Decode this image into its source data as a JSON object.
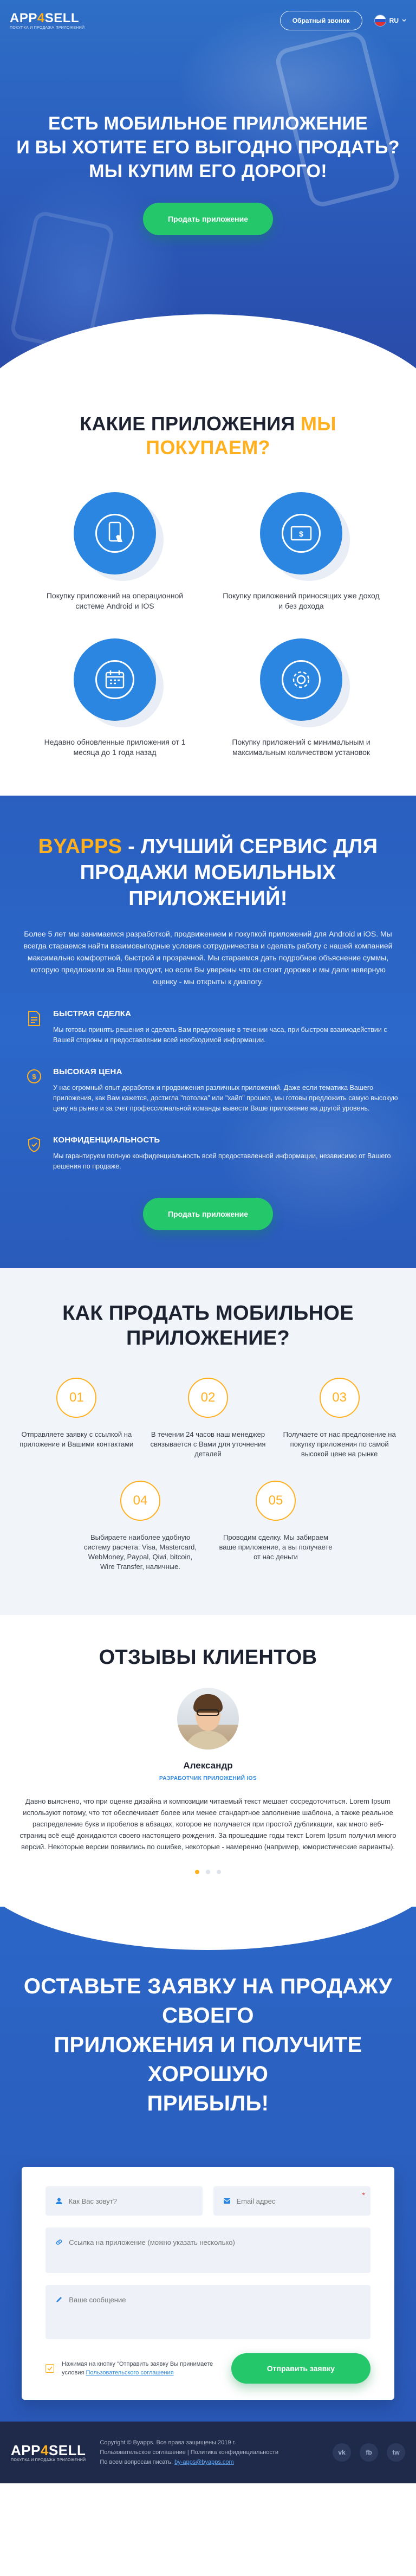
{
  "header": {
    "logo_text_a": "APP",
    "logo_text_num": "4",
    "logo_text_b": "SELL",
    "logo_tagline": "ПОКУПКА И ПРОДАЖА ПРИЛОЖЕНИЙ",
    "callback_label": "Обратный звонок",
    "lang_label": "RU"
  },
  "hero": {
    "title_line1": "ЕСТЬ МОБИЛЬНОЕ ПРИЛОЖЕНИЕ",
    "title_line2": "И ВЫ ХОТИТЕ ЕГО ВЫГОДНО ПРОДАТЬ?",
    "title_line3": "МЫ КУПИМ ЕГО ДОРОГО!",
    "cta_label": "Продать приложение"
  },
  "buy": {
    "title_main": "КАКИЕ ПРИЛОЖЕНИЯ ",
    "title_accent": "МЫ ПОКУПАЕМ?",
    "items": [
      {
        "text": "Покупку приложений на операционной системе Android и IOS",
        "icon": "phone-touch-icon"
      },
      {
        "text": "Покупку приложений приносящих уже доход и без дохода",
        "icon": "money-icon"
      },
      {
        "text": "Недавно обновленные приложения от 1 месяца до 1 года назад",
        "icon": "calendar-icon"
      },
      {
        "text": "Покупку приложений с минимальным и максимальным количеством установок",
        "icon": "settings-icon"
      }
    ]
  },
  "why": {
    "title_accent": "BYAPPS",
    "title_rest": " - ЛУЧШИЙ СЕРВИС ДЛЯ ПРОДАЖИ МОБИЛЬНЫХ ПРИЛОЖЕНИЙ!",
    "intro": "Более 5 лет мы занимаемся разработкой, продвижением и покупкой приложений для Android и iOS. Мы всегда стараемся найти взаимовыгодные условия сотрудничества и сделать работу с нашей компанией максимально комфортной, быстрой и прозрачной. Мы стараемся дать подробное объяснение суммы, которую предложили за Ваш продукт, но если Вы уверены что он стоит дороже и мы дали неверную оценку - мы открыты к диалогу.",
    "features": [
      {
        "title": "БЫСТРАЯ СДЕЛКА",
        "text": "Мы готовы принять решения и сделать Вам предложение в течении часа, при быстром взаимодействии с Вашей стороны и предоставлении всей необходимой информации."
      },
      {
        "title": "ВЫСОКАЯ ЦЕНА",
        "text": "У нас огромный опыт доработок и продвижения различных приложений. Даже если тематика Вашего приложения, как Вам кажется, достигла \"потолка\" или \"хайп\" прошел, мы готовы предложить самую высокую цену на рынке и за счет профессиональной команды вывести Ваше приложение на другой уровень."
      },
      {
        "title": "КОНФИДЕНЦИАЛЬНОСТЬ",
        "text": "Мы гарантируем полную конфиденциальность всей предоставленной информации, независимо от Вашего решения по продаже."
      }
    ],
    "cta_label": "Продать приложение"
  },
  "how": {
    "title_line1": "КАК ПРОДАТЬ МОБИЛЬНОЕ",
    "title_line2": "ПРИЛОЖЕНИЕ?",
    "steps": [
      {
        "num": "01",
        "text": "Отправляете заявку с ссылкой на приложение и Вашими контактами"
      },
      {
        "num": "02",
        "text": "В течении 24 часов наш менеджер связывается с Вами для уточнения деталей"
      },
      {
        "num": "03",
        "text": "Получаете от нас предложение на покупку приложения по самой высокой цене на рынке"
      },
      {
        "num": "04",
        "text": "Выбираете наиболее удобную систему расчета: Visa, Mastercard, WebMoney, Paypal, Qiwi, bitcoin, Wire Transfer, наличные."
      },
      {
        "num": "05",
        "text": "Проводим сделку. Мы забираем ваше приложение, а вы получаете от нас деньги"
      }
    ]
  },
  "reviews": {
    "title": "ОТЗЫВЫ КЛИЕНТОВ",
    "name": "Александр",
    "role": "РАЗРАБОТЧИК ПРИЛОЖЕНИЙ IOS",
    "text": "Давно выяснено, что при оценке дизайна и композиции читаемый текст мешает сосредоточиться. Lorem Ipsum используют потому, что тот обеспечивает более или менее стандартное заполнение шаблона, а также реальное распределение букв и пробелов в абзацах, которое не получается при простой дубликации, как много веб-страниц всё ещё дожидаются своего настоящего рождения. За прошедшие годы текст Lorem Ipsum получил много версий. Некоторые версии появились по ошибке, некоторые - намеренно (например, юмористические варианты)."
  },
  "request": {
    "title_line1": "ОСТАВЬТЕ ЗАЯВКУ НА ПРОДАЖУ СВОЕГО",
    "title_line2": "ПРИЛОЖЕНИЯ И ПОЛУЧИТЕ ХОРОШУЮ",
    "title_line3": "ПРИБЫЛЬ!",
    "name_placeholder": "Как Вас зовут?",
    "email_placeholder": "Email адрес",
    "link_placeholder": "Ссылка на приложение (можно указать несколько)",
    "message_placeholder": "Ваше сообщение",
    "consent_text": "Нажимая на кнопку \"Отправить заявку Вы принимаете условия ",
    "consent_link": "Пользовательского соглашения",
    "submit_label": "Отправить заявку"
  },
  "footer": {
    "copyright": "Copyright © Byapps. Все права защищены 2019 г.",
    "links": "Пользовательское соглашение | Политика конфиденциальности",
    "contact_prefix": "По всем вопросам писать: ",
    "contact_email": "by-apps@byapps.com",
    "socials": [
      "vk",
      "fb",
      "tw"
    ]
  },
  "colors": {
    "accent": "#ffb020",
    "primary": "#2a86e0",
    "green": "#24c76a",
    "hero": "#2b5fbf",
    "footer": "#1f2a4a"
  }
}
